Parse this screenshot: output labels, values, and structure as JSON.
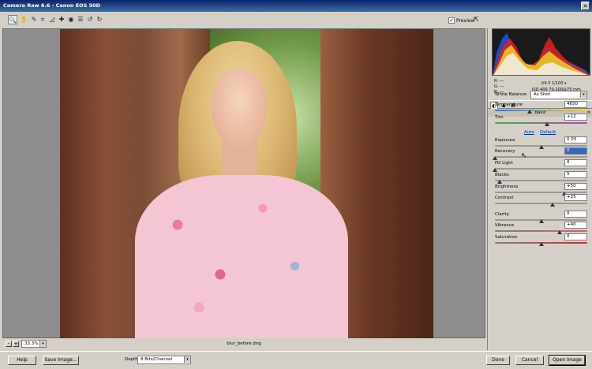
{
  "window": {
    "title": "Camera Raw 6.6 - Canon EOS 50D",
    "close_glyph": "✕"
  },
  "toolbar": {
    "tools": [
      {
        "name": "zoom-tool-icon",
        "glyph": "🔍"
      },
      {
        "name": "hand-tool-icon",
        "glyph": "✋"
      },
      {
        "name": "eyedropper-tool-icon",
        "glyph": "✎"
      },
      {
        "name": "crop-tool-icon",
        "glyph": "⌗"
      },
      {
        "name": "straighten-tool-icon",
        "glyph": "◿"
      },
      {
        "name": "retouch-tool-icon",
        "glyph": "✚"
      },
      {
        "name": "redeye-tool-icon",
        "glyph": "◉"
      },
      {
        "name": "preferences-icon",
        "glyph": "☰"
      },
      {
        "name": "rotate-left-icon",
        "glyph": "↺"
      },
      {
        "name": "rotate-right-icon",
        "glyph": "↻"
      }
    ],
    "preview_label": "Preview",
    "preview_checked": "✓",
    "fullscreen_glyph": "⇱"
  },
  "canvas": {
    "filename": "blur_before.dng",
    "zoom_value": "33.3%",
    "zoom_minus": "-",
    "zoom_plus": "+"
  },
  "readout": {
    "r": "R:  ---",
    "g": "G:  ---",
    "b": "B:  ---",
    "aperture_shutter": "f/4.5   1/100 s",
    "iso_lens": "ISO 400   70-200@75 mm"
  },
  "panel": {
    "section_title": "Basic",
    "section_menu": "≡",
    "white_balance_label": "White Balance:",
    "white_balance_value": "As Shot",
    "auto_label": "Auto",
    "default_label": "Default",
    "adjustments": [
      {
        "label": "Temperature",
        "value": "4650",
        "pos": 0.38
      },
      {
        "label": "Tint",
        "value": "+12",
        "pos": 0.56
      },
      {
        "label": "Exposure",
        "value": "0.00",
        "pos": 0.5
      },
      {
        "label": "Recovery",
        "value": "0",
        "pos": 0.0
      },
      {
        "label": "Fill Light",
        "value": "0",
        "pos": 0.0
      },
      {
        "label": "Blacks",
        "value": "5",
        "pos": 0.05
      },
      {
        "label": "Brightness",
        "value": "+50",
        "pos": 0.75
      },
      {
        "label": "Contrast",
        "value": "+25",
        "pos": 0.62
      },
      {
        "label": "Clarity",
        "value": "0",
        "pos": 0.5
      },
      {
        "label": "Vibrance",
        "value": "+40",
        "pos": 0.7
      },
      {
        "label": "Saturation",
        "value": "0",
        "pos": 0.5
      }
    ]
  },
  "bottom": {
    "help": "Help",
    "save": "Save Image...",
    "depth_label": "Depth:",
    "depth_value": "8 Bits/Channel",
    "done": "Done",
    "cancel": "Cancel",
    "open": "Open Image"
  },
  "dropdown_glyph": "▾"
}
